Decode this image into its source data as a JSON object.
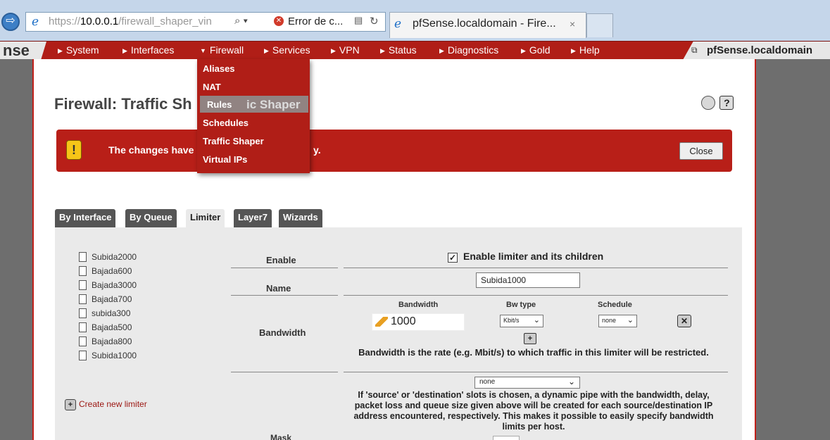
{
  "browser": {
    "url_scheme": "https://",
    "url_host": "10.0.0.1",
    "url_path": "/firewall_shaper_vin",
    "search_glyph": "⌕ ▾",
    "error_label": "Error de c...",
    "tab_title": "pfSense.localdomain - Fire...",
    "tab_close": "×"
  },
  "nav": {
    "logo": "nse",
    "items": [
      "System",
      "Interfaces",
      "Firewall",
      "Services",
      "VPN",
      "Status",
      "Diagnostics",
      "Gold",
      "Help"
    ],
    "host": "pfSense.localdomain"
  },
  "dropdown": {
    "items": [
      "Aliases",
      "NAT",
      "Rules",
      "Schedules",
      "Traffic Shaper",
      "Virtual IPs"
    ],
    "hovered": "Rules",
    "ghost_text": "ic Shaper"
  },
  "page": {
    "title": "Firewall: Traffic Sh",
    "alert_text": "The changes have",
    "alert_tail": "y.",
    "close_label": "Close"
  },
  "tabs": [
    "By Interface",
    "By Queue",
    "Limiter",
    "Layer7",
    "Wizards"
  ],
  "active_tab": "Limiter",
  "limiters": [
    "Subida2000",
    "Bajada600",
    "Bajada3000",
    "Bajada700",
    "subida300",
    "Bajada500",
    "Bajada800",
    "Subida1000"
  ],
  "create_new": "Create new limiter",
  "form": {
    "enable_label": "Enable",
    "enable_checkbox": "Enable limiter and its children",
    "enable_checked": "✓",
    "name_label": "Name",
    "name_value": "Subida1000",
    "bandwidth_label": "Bandwidth",
    "bw_col": "Bandwidth",
    "bwtype_col": "Bw type",
    "schedule_col": "Schedule",
    "bandwidth_value": "1000",
    "bwtype_value": "Kbit/s",
    "schedule_value": "none",
    "bandwidth_help": "Bandwidth is the rate (e.g. Mbit/s) to which traffic in this limiter will be restricted.",
    "mask_label": "Mask",
    "mask_value": "none",
    "mask_help": "If 'source' or 'destination' slots is chosen, a dynamic pipe with the bandwidth, delay, packet loss and queue size given above will be created for each source/destination IP address encountered, respectively. This makes it possible to easily specify bandwidth limits per host."
  },
  "colors": {
    "nav_red": "#b01e17",
    "alert_red": "#b81f18",
    "tab_gray": "#555555",
    "panel_gray": "#eaeaea"
  },
  "icons": [
    "back-arrow-icon",
    "ie-logo-icon",
    "search-icon",
    "error-icon",
    "document-icon",
    "reload-icon",
    "close-tab-icon",
    "network-icon",
    "refresh-circle-icon",
    "help-icon",
    "warning-icon",
    "document-icon",
    "add-icon",
    "delete-icon",
    "pencil-icon",
    "chevron-down-icon"
  ]
}
